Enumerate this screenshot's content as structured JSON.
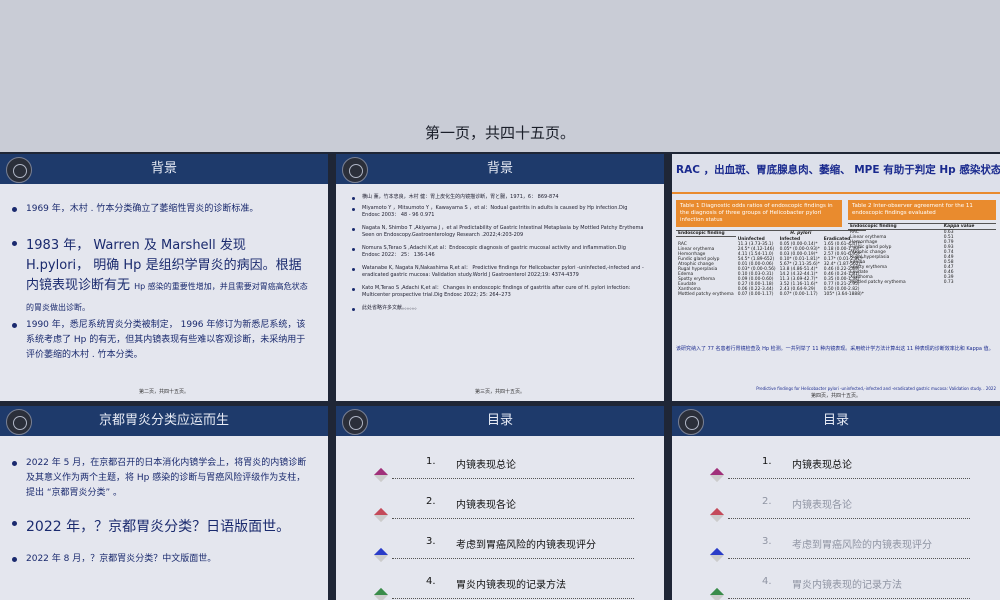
{
  "top_caption": "第一页，共四十五页。",
  "slide2": {
    "title": "背景",
    "b1": "1969 年，木村 . 竹本分类确立了萎缩性胃炎的诊断标准。",
    "b2a": "1983 年， Warren 及 Marshell 发现 H.pylori， 明确 Hp 是组织学胃炎的病因。根据内镜表现诊断有无",
    "b2b": "Hp 感染的重要性增加，并且需要对胃癌高危状态的胃炎做出诊断。",
    "b3": "1990 年，悉尼系统胃炎分类被制定， 1996 年修订为新悉尼系统，该系统考虑了 Hp 的有无，但其内镜表现有些难以客观诊断，未采纳用于评价萎缩的木村 . 竹本分类。",
    "footer": "第二页，共四十五页。"
  },
  "slide3": {
    "title": "背景",
    "refs": [
      "横山 薰，竹本忠良，木村 健：胃上皮化生的内镜描诊断，胃と腸，1971，6： 869-874",
      "Miyamoto Y ，Mitsumoto Y ，Kawayama S ，et al：Nodual gastritis in adults is caused by Hp infection.Dig Endosc 2003： 48 - 96 0.971",
      "Nagata N, Shimbo T ,Akiyama J ，et al Predictability of Gastric Intestinal Metaplasia by Mottled Patchy Erythema Seen on Endoscopy.Gastroenterology Research .2022;4:203-209",
      "Nomura S,Terao S ,Adachi K,et al：Endoscopic diagnosis of gastric mucosal activity and inflammation.Dig Endosc 2022： 25： 136-146",
      "Watanabe K, Nagata N,Nakashima R,et al： Predictive findings for Helicobacter pylori -uninfected,-infected and -eradicated gastric mucosa: Validation study.World J Gastroenterol 2022;19: 4374-4379",
      "Kato M,Terao S ,Adachi K,et al： Changes in endoscopic findings of gastritis after cure of H. pylori infection: Multicenter prospective trial.Dig Endosc 2022; 25: 264–273",
      "此处省略许多文献。。。。。。"
    ],
    "footer": "第三页，共四十五页。"
  },
  "slide4": {
    "title": "RAC ，出血斑、胃底腺息肉、萎缩、 MPE 有助于判定 Hp 感染状态。",
    "table1_caption": "Table 1 Diagnostic odds ratios of endoscopic findings in the diagnosis of three groups of Helicobacter pylori infection status",
    "table2_caption": "Table 2 Inter-observer agreement for the 11 endoscopic findings evaluated",
    "t1_head": [
      "Endoscopic finding",
      "Uninfected",
      "Infected",
      "Eradicated"
    ],
    "t1_group": "H. pylori",
    "t1_rows": [
      [
        "RAC",
        "11.3 (3.73-35.1)",
        "0.05 (0.00-0.14)*",
        "1.65 (0.61-4.47)*"
      ],
      [
        "Linear erythema",
        "24.5* (4.12-146)",
        "0.05* (0.00-0.93)*",
        "0.18 (0.00-1.39)*"
      ],
      [
        "Hemorrhage",
        "4.11 (1.54-11.0)",
        "0.03 (0.00-0.19)*",
        "2.57 (0.91-6.95)*"
      ],
      [
        "Fundic gland polyp",
        "54.5* (1.89-652)",
        "0.10* (0.01-1.81)*",
        "0.17* (0.01-2.81)*"
      ],
      [
        "Atrophic change",
        "0.01 (0.00-0.06)",
        "5.67* (2.11-35.6)*",
        "32.4* (1.87-562)*"
      ],
      [
        "Rugal hyperplasia",
        "0.03* (0.00-0.56)",
        "13.8 (4.86-51.4)*",
        "0.46 (0.22-2.69)"
      ],
      [
        "Edema",
        "0.10 (0.03-0.31)",
        "14.2 (4.32-44.1)*",
        "0.46 (0.24-1.81)"
      ],
      [
        "Spotty erythema",
        "0.09 (0.00-0.60)",
        "11.3 (3.69-42.7)*",
        "0.35 (0.00-1.34)"
      ],
      [
        "Exudate",
        "0.27 (0.00-1.18)",
        "3.52 (1.16-11.6)*",
        "0.77 (0.21-2.95)"
      ],
      [
        "Xanthoma",
        "0.06 (0.22-3.44)",
        "2.43 (0.64-9.29)",
        "0.50 (0.00-2.82)"
      ],
      [
        "Mottled patchy erythema",
        "0.07 (0.00-1.17)",
        "0.07* (0.00-1.17)",
        "105* (3.64-1888)*"
      ]
    ],
    "t2_head": [
      "Endoscopic finding",
      "Kappa value"
    ],
    "t2_rows": [
      [
        "RAC",
        "0.63"
      ],
      [
        "Linear erythema",
        "0.51"
      ],
      [
        "Hemorrhage",
        "0.79"
      ],
      [
        "Fundic gland polyp",
        "0.93"
      ],
      [
        "Atrophic change",
        "0.74"
      ],
      [
        "Rugal hyperplasia",
        "0.49"
      ],
      [
        "Edema",
        "0.58"
      ],
      [
        "Spotty erythema",
        "0.47"
      ],
      [
        "Exudate",
        "0.46"
      ],
      [
        "Xanthoma",
        "0.39"
      ],
      [
        "Mottled patchy erythema",
        "0.73"
      ]
    ],
    "note": "该研究纳入了 77 名患者行胃镜检查及 Hp 检测。一共列举了 11 种内镜表现。采用统计学方法计算出这 11 种表现的诊断效率比和 Kappa 值。",
    "source": "Predictive findings for Helicobacter pylori -uninfected,-infected and -eradicated gastric mucosa: Validation study. . 2022",
    "footer": "第四页，共四十五页。"
  },
  "slide5": {
    "title": "京都胃炎分类应运而生",
    "b1": "2022 年 5 月，在京都召开的日本消化内镜学会上，将胃炎的内镜诊断及其意义作为两个主题，将 Hp 感染的诊断与胃癌风险评级作为支柱，提出 “京都胃炎分类” 。",
    "b2": "2022 年，？京都胃炎分类？日语版面世。",
    "b3": "2022 年 8 月，？京都胃炎分类？中文版面世。"
  },
  "slide6": {
    "title": "目录",
    "items": [
      {
        "num": "1.",
        "label": "内镜表现总论"
      },
      {
        "num": "2.",
        "label": "内镜表现各论"
      },
      {
        "num": "3.",
        "label": "考虑到胃癌风险的内镜表现评分"
      },
      {
        "num": "4.",
        "label": "胃炎内镜表现的记录方法"
      }
    ]
  },
  "slide7": {
    "title": "目录",
    "items": [
      {
        "num": "1.",
        "label": "内镜表现总论"
      },
      {
        "num": "2.",
        "label": "内镜表现各论"
      },
      {
        "num": "3.",
        "label": "考虑到胃癌风险的内镜表现评分"
      },
      {
        "num": "4.",
        "label": "胃炎内镜表现的记录方法"
      }
    ]
  },
  "colors": {
    "header": "#1e3a6b",
    "slide_bg": "#e4e6ee",
    "accent_orange": "#e98b2e",
    "text_blue": "#1a2a6e"
  }
}
